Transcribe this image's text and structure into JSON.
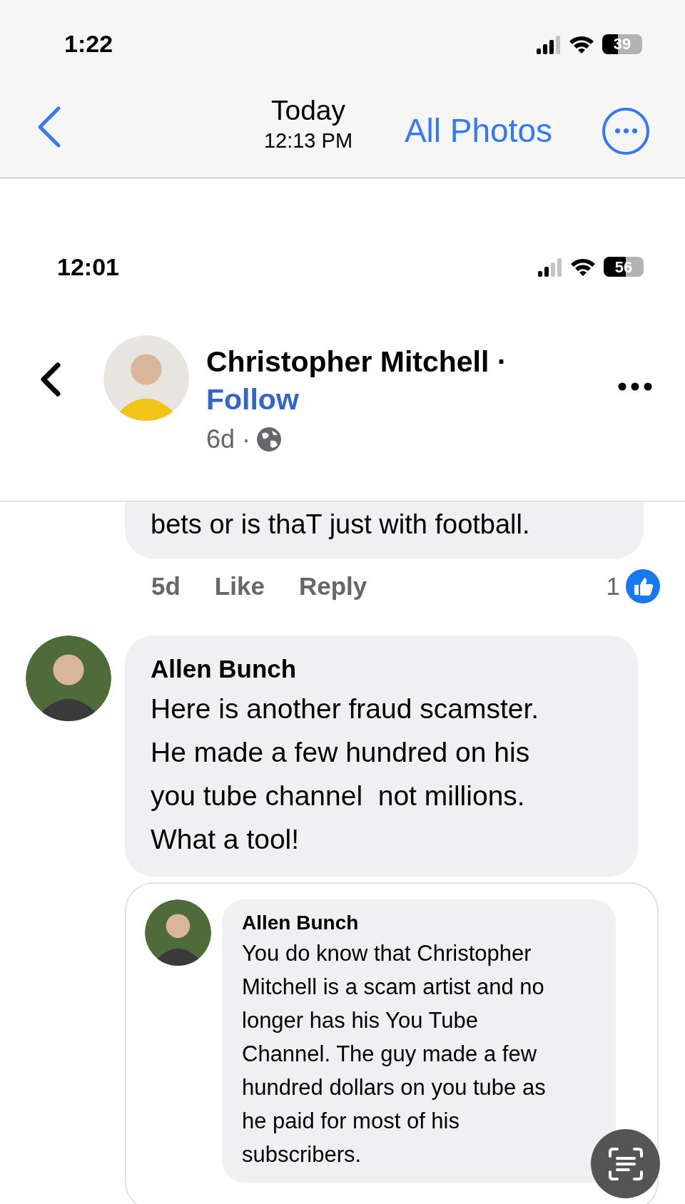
{
  "photos_status_bar": {
    "time": "1:22",
    "battery": "39"
  },
  "photos_nav": {
    "title": "Today",
    "subtitle": "12:13 PM",
    "action": "All Photos"
  },
  "screenshot": {
    "status_bar": {
      "time": "12:01",
      "battery": "56"
    },
    "post_header": {
      "author": "Christopher Mitchell ·",
      "follow": "Follow",
      "age": "6d ·"
    },
    "previous_comment": {
      "text": "bets or is thaT just with football.",
      "age": "5d",
      "like": "Like",
      "reply": "Reply",
      "reactions": "1"
    },
    "comment": {
      "author": "Allen Bunch",
      "lines": [
        "Here is another fraud scamster.",
        "He made a few hundred on his",
        "you tube channel  not millions.",
        "What a tool!"
      ],
      "shared_comment": {
        "author": "Allen Bunch",
        "lines": [
          "You do know that Christopher",
          "Mitchell is a scam artist and no",
          "longer has his You Tube",
          "Channel. The guy made a few",
          "hundred dollars on you tube as",
          "he paid for most of his",
          "subscribers."
        ]
      }
    }
  }
}
